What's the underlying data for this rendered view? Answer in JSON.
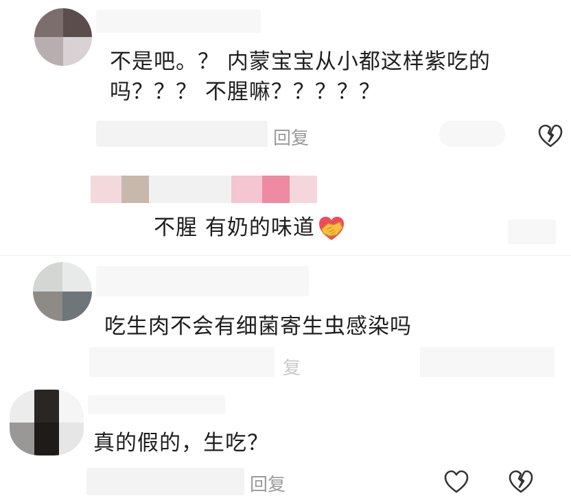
{
  "comments": [
    {
      "text_lines": [
        "不是吧。？ 内蒙宝宝从小都这样紫吃的",
        "吗？？？ 不腥嘛？？？？？"
      ],
      "reply_label": "回复"
    },
    {
      "reply": true,
      "text": "不腥 有奶的味道",
      "emoji": "handshake-emoji"
    },
    {
      "text_lines": [
        "吃生肉不会有细菌寄生虫感染吗"
      ],
      "reply_label": "复"
    },
    {
      "text_lines": [
        "真的假的，生吃？"
      ],
      "reply_label": "回复"
    }
  ],
  "icons": {
    "like": "heart-outline-icon",
    "dislike": "broken-heart-icon",
    "emoji": "handshake-emoji"
  },
  "colors": {
    "text": "#1e1e1e",
    "muted": "#9a9a9a",
    "icon": "#333333",
    "blur": "#f3f3f3",
    "emoji_heart": "#ef4a5a",
    "emoji_hand": "#f6c042"
  }
}
